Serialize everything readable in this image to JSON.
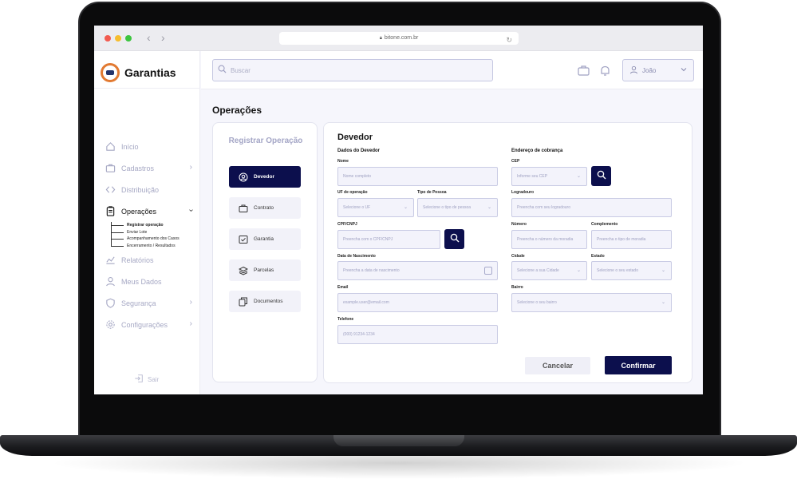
{
  "browser": {
    "url": "bitone.com.br"
  },
  "brand": {
    "name": "Garantias"
  },
  "sidebar": {
    "items": [
      {
        "label": "Início",
        "icon": "home-icon"
      },
      {
        "label": "Cadastros",
        "icon": "briefcase-icon"
      },
      {
        "label": "Distribuição",
        "icon": "code-icon"
      },
      {
        "label": "Operações",
        "icon": "clipboard-icon"
      },
      {
        "label": "Relatórios",
        "icon": "chart-icon"
      },
      {
        "label": "Meus Dados",
        "icon": "user-icon"
      },
      {
        "label": "Segurança",
        "icon": "shield-icon"
      },
      {
        "label": "Configurações",
        "icon": "gear-icon"
      }
    ],
    "subitems": [
      {
        "label": "Registrar operação"
      },
      {
        "label": "Enviar Lote"
      },
      {
        "label": "Acompanhamento dos Casos"
      },
      {
        "label": "Encerramento / Resultados"
      }
    ],
    "logout_label": "Sair"
  },
  "header": {
    "search_placeholder": "Buscar",
    "user_name": "João"
  },
  "page": {
    "title": "Operações"
  },
  "steps": {
    "title": "Registrar Operação",
    "items": [
      {
        "label": "Devedor",
        "icon": "user-circle-icon",
        "active": true
      },
      {
        "label": "Contrato",
        "icon": "briefcase-icon"
      },
      {
        "label": "Garantia",
        "icon": "check-box-icon"
      },
      {
        "label": "Parcelas",
        "icon": "layers-icon"
      },
      {
        "label": "Documentos",
        "icon": "documents-icon"
      }
    ]
  },
  "form": {
    "title": "Devedor",
    "debtor_section": "Dados do Devedor",
    "address_section": "Endereço de cobrança",
    "fields": {
      "nome": {
        "label": "Nome",
        "placeholder": "Nome completo"
      },
      "uf": {
        "label": "UF de operação",
        "placeholder": "Selecione o UF"
      },
      "tipo_pessoa": {
        "label": "Tipo de Pessoa",
        "placeholder": "Selecione o tipo de pessoa"
      },
      "cpf": {
        "label": "CPF/CNPJ",
        "placeholder": "Preencha com o CPF/CNPJ"
      },
      "nascimento": {
        "label": "Data de Nascimento",
        "placeholder": "Preencha a data de nascimento"
      },
      "email": {
        "label": "Email",
        "placeholder": "example.user@email.com"
      },
      "telefone": {
        "label": "Telefone",
        "placeholder": "(000) 91234-1234"
      },
      "cep": {
        "label": "CEP",
        "placeholder": "Informe seu CEP"
      },
      "logradouro": {
        "label": "Logradouro",
        "placeholder": "Preencha com seu logradouro"
      },
      "numero": {
        "label": "Número",
        "placeholder": "Preencha o número da moradia"
      },
      "complemento": {
        "label": "Complemento",
        "placeholder": "Preencha o tipo de moradia"
      },
      "cidade": {
        "label": "Cidade",
        "placeholder": "Selecione a sua Cidade"
      },
      "estado": {
        "label": "Estado",
        "placeholder": "Selecione o seu estado"
      },
      "bairro": {
        "label": "Bairro",
        "placeholder": "Selecione o seu bairro"
      }
    },
    "cancel_label": "Cancelar",
    "confirm_label": "Confirmar"
  },
  "colors": {
    "primary": "#0c0f4d",
    "accent_logo": "#e27a32",
    "muted_nav": "#a6a8c4",
    "field_bg": "#f3f3fb",
    "field_border": "#c9cbe4"
  }
}
